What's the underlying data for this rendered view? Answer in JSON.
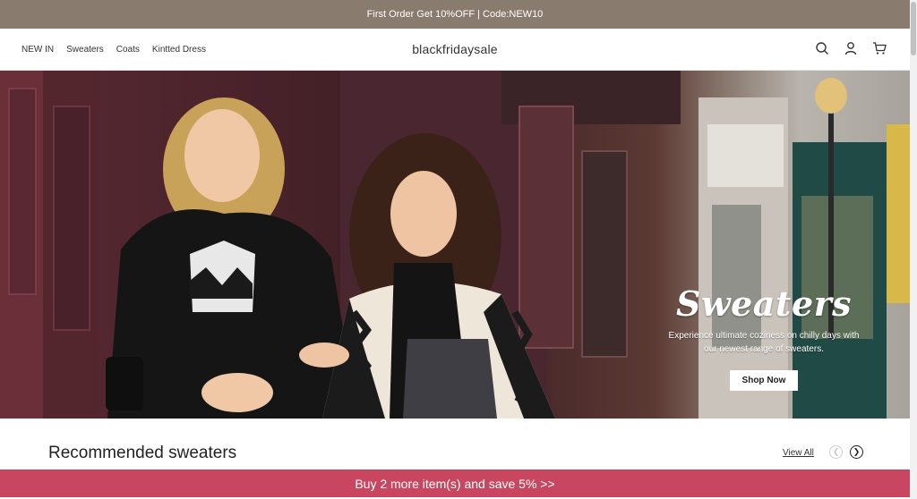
{
  "promo": {
    "text": "First Order Get 10%OFF | Code:NEW10"
  },
  "header": {
    "nav": [
      "NEW IN",
      "Sweaters",
      "Coats",
      "Kintted Dress"
    ],
    "brand": "blackfridaysale",
    "icons": [
      "search-icon",
      "user-icon",
      "cart-icon"
    ]
  },
  "hero": {
    "title": "Sweaters",
    "subtitle_line1": "Experience ultimate coziness on chilly days with",
    "subtitle_line2": "our newest range of sweaters.",
    "button": "Shop Now"
  },
  "recommended": {
    "title": "Recommended sweaters",
    "view_all": "View All"
  },
  "save_bar": {
    "text": "Buy 2 more item(s) and save 5% >>"
  },
  "colors": {
    "promo_bg": "#8a7b6f",
    "save_bar_bg": "#c8465f"
  }
}
